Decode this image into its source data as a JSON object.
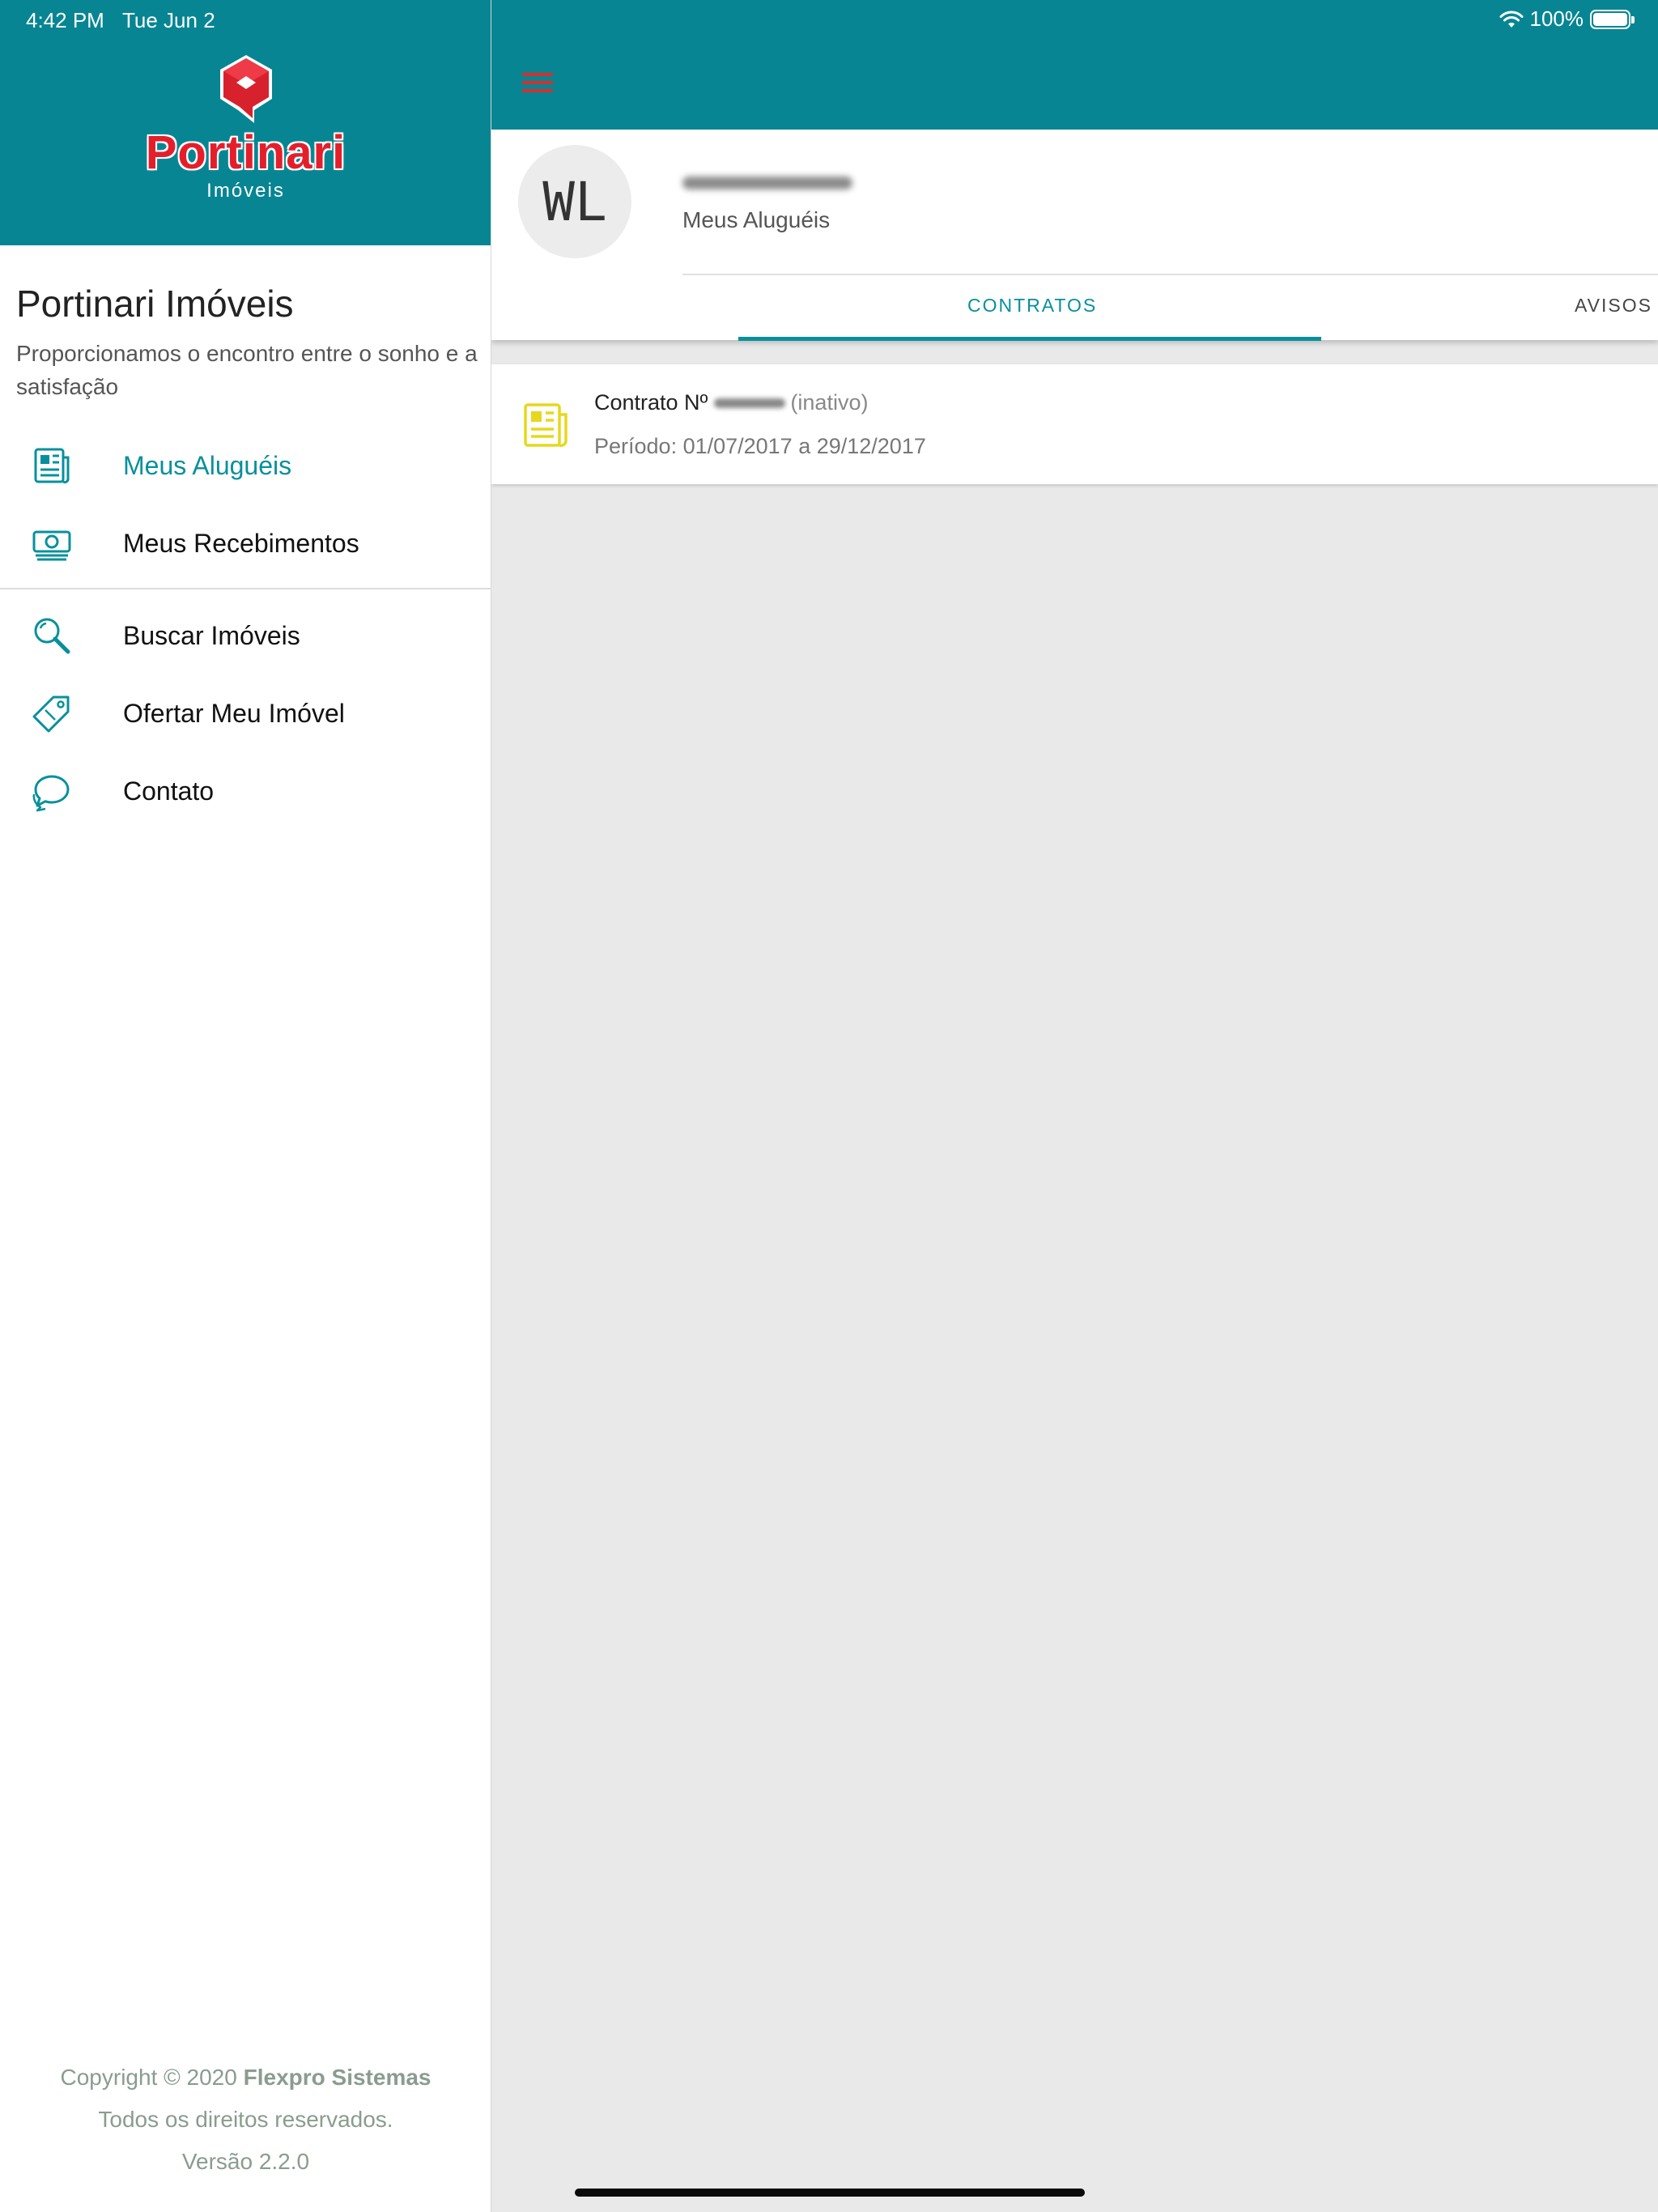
{
  "status_bar": {
    "time": "4:42 PM",
    "date": "Tue Jun 2",
    "battery": "100%"
  },
  "sidebar": {
    "logo": {
      "word": "Portinari",
      "sub": "Imóveis"
    },
    "title": "Portinari Imóveis",
    "tagline": "Proporcionamos o encontro entre o sonho e a satisfação",
    "items": [
      {
        "label": "Meus Aluguéis",
        "icon": "newspaper-icon",
        "active": true
      },
      {
        "label": "Meus Recebimentos",
        "icon": "money-icon",
        "active": false
      },
      {
        "label": "Buscar Imóveis",
        "icon": "search-icon",
        "active": false
      },
      {
        "label": "Ofertar Meu Imóvel",
        "icon": "tag-icon",
        "active": false
      },
      {
        "label": "Contato",
        "icon": "chat-icon",
        "active": false
      }
    ],
    "footer": {
      "copyright_prefix": "Copyright © 2020 ",
      "company": "Flexpro Sistemas",
      "rights": "Todos os direitos reservados.",
      "version": "Versão 2.2.0"
    }
  },
  "main": {
    "profile": {
      "initials": "WL",
      "subtitle": "Meus Aluguéis"
    },
    "tabs": [
      {
        "label": "CONTRATOS",
        "active": true
      },
      {
        "label": "AVISOS",
        "active": false
      }
    ],
    "contracts": [
      {
        "title": "Contrato Nº",
        "status": "(inativo)",
        "period": "Período: 01/07/2017 a 29/12/2017"
      }
    ]
  },
  "colors": {
    "primary": "#078593",
    "accent_text": "#07909c",
    "logo_red": "#e41f2c",
    "menu_button": "#d33030",
    "contract_icon": "#e6d81e",
    "background": "#e9e9e9"
  }
}
